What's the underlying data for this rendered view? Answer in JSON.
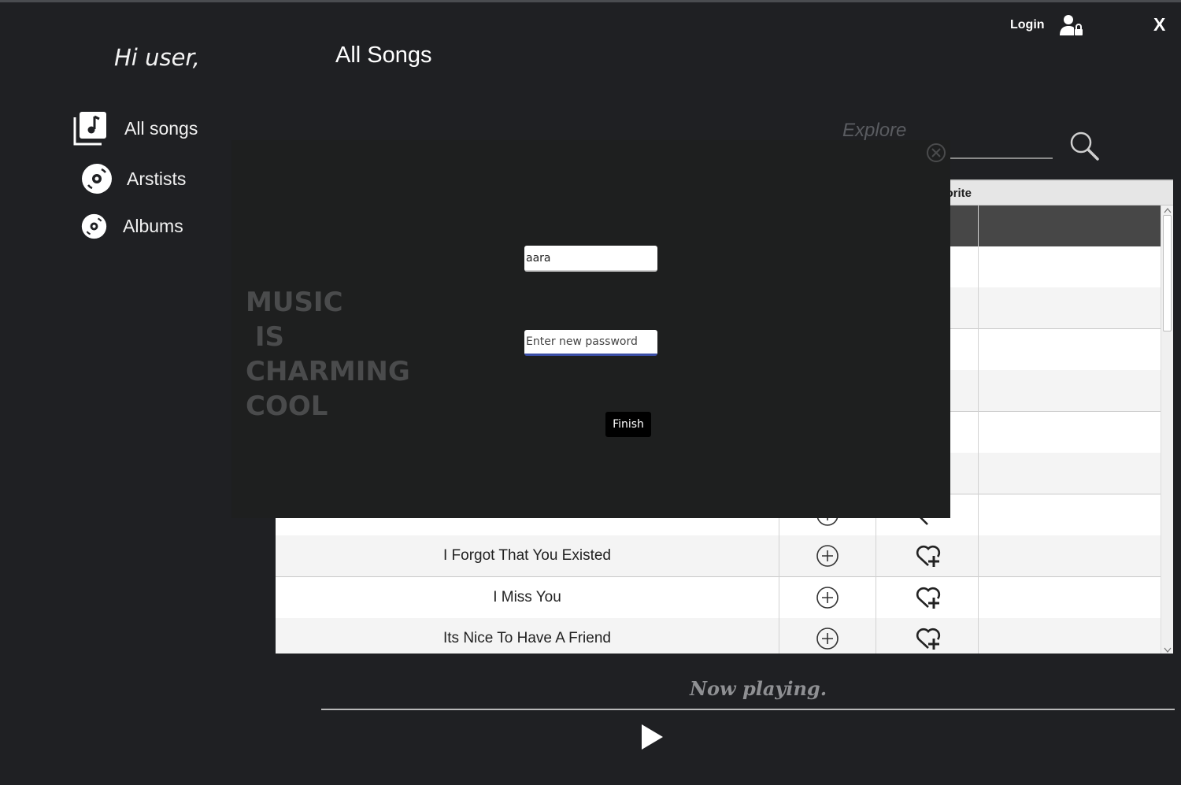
{
  "header": {
    "greeting": "Hi user,",
    "page_title": "All Songs",
    "login_label": "Login",
    "close_label": "X"
  },
  "sidebar": {
    "items": [
      {
        "label": "All songs",
        "icon": "music-library-icon"
      },
      {
        "label": "Arstists",
        "icon": "vinyl-disc-icon"
      },
      {
        "label": "Albums",
        "icon": "vinyl-disc-icon"
      }
    ]
  },
  "search": {
    "placeholder": "Explore",
    "icon": "search-icon"
  },
  "table": {
    "favorite_header_fragment": "orite",
    "rows": [
      {
        "title": "I Forgot That You Existed"
      },
      {
        "title": "I Miss You"
      },
      {
        "title": "Its Nice To Have A Friend"
      }
    ]
  },
  "modal": {
    "tagline": "MUSIC\n IS\nCHARMING\nCOOL",
    "username_value": "aara",
    "password_placeholder": "Enter new password",
    "finish_label": "Finish"
  },
  "player": {
    "status": "Now playing."
  },
  "colors": {
    "background": "#1f2023",
    "modal": "#1e1f1f",
    "table_selected": "#474747",
    "password_focus": "#3b4ea6"
  }
}
